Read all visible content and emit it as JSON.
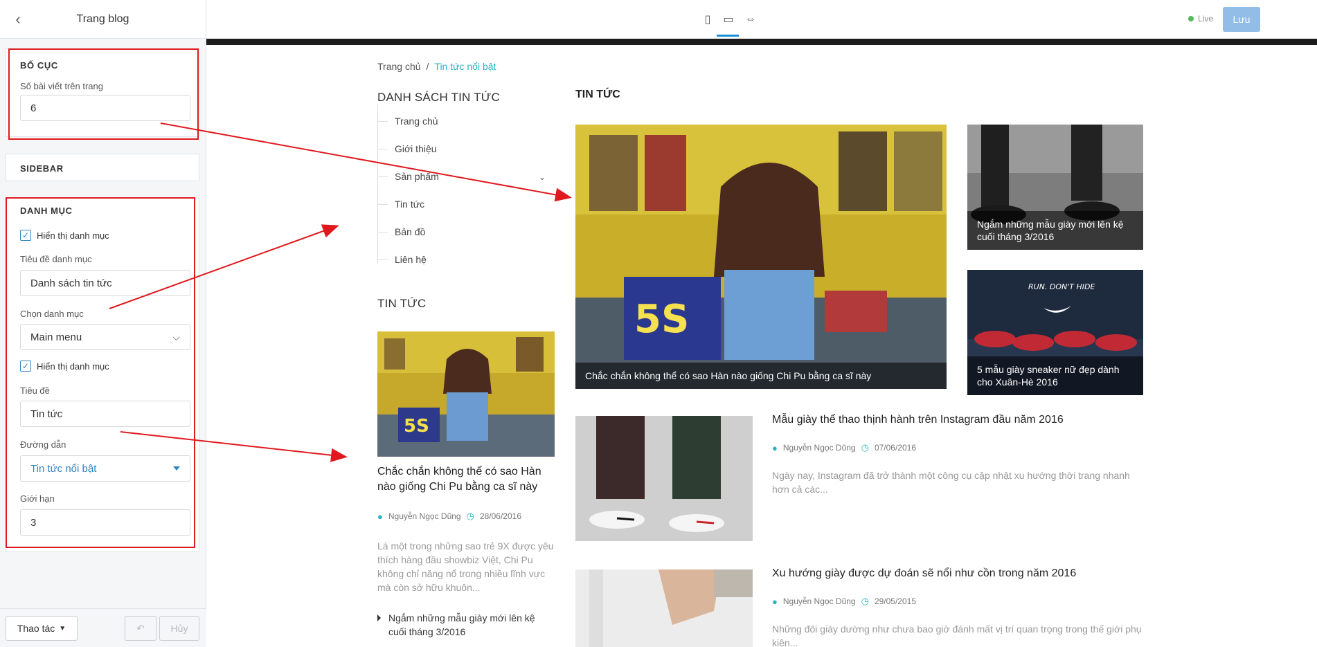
{
  "editor": {
    "title": "Trang blog",
    "back_icon": "chevron-left-icon",
    "layout": {
      "heading": "BỐ CỤC",
      "posts_per_page_label": "Số bài viết trên trang",
      "posts_per_page_value": "6"
    },
    "sidebar_section": {
      "heading": "SIDEBAR"
    },
    "category": {
      "heading": "DANH MỤC",
      "show_category_label": "Hiển thị danh mục",
      "show_category_checked": true,
      "category_title_label": "Tiêu đề danh mục",
      "category_title_value": "Danh sách tin tức",
      "choose_category_label": "Chọn danh mục",
      "choose_category_value": "Main menu",
      "show_category2_label": "Hiển thị danh mục",
      "show_category2_checked": true,
      "title_label": "Tiêu đề",
      "title_value": "Tin tức",
      "path_label": "Đường dẫn",
      "path_value": "Tin tức nổi bật",
      "limit_label": "Giới hạn",
      "limit_value": "3"
    },
    "footer": {
      "actions_label": "Thao tác",
      "cancel_label": "Hủy"
    }
  },
  "topbar": {
    "live_label": "Live",
    "save_label": "Lưu",
    "devices": [
      "mobile-icon",
      "desktop-icon",
      "full-width-icon"
    ],
    "accent": "#1a8fd8"
  },
  "preview": {
    "breadcrumb": {
      "home": "Trang chủ",
      "separator": "/",
      "current": "Tin tức nổi bật"
    },
    "nav_heading": "DANH SÁCH TIN TỨC",
    "nav_items": [
      "Trang chủ",
      "Giới thiệu",
      "Sản phẩm",
      "Tin tức",
      "Bản đồ",
      "Liên hệ"
    ],
    "news_heading": "TIN TỨC",
    "side_post": {
      "title": "Chắc chắn không thể có sao Hàn nào giống Chi Pu bằng ca sĩ này",
      "author": "Nguyễn Ngọc Dũng",
      "date": "28/06/2016",
      "excerpt": "Là một trong những sao trẻ 9X được yêu thích hàng đầu showbiz Việt, Chi Pu không chỉ năng nổ trong nhiều lĩnh vực mà còn sở hữu khuôn..."
    },
    "side_link": "Ngắm những mẫu giày mới lên kệ cuối tháng 3/2016",
    "main_heading": "TIN TỨC",
    "featured": [
      {
        "caption": "Chắc chắn không thể có sao Hàn nào giống Chi Pu bằng ca sĩ này"
      },
      {
        "caption": "Ngắm những mẫu giày mới lên kệ cuối tháng 3/2016"
      },
      {
        "caption": "5 mẫu giày sneaker nữ đẹp dành cho Xuân-Hè 2016"
      }
    ],
    "posts": [
      {
        "title": "Mẫu giày thể thao thịnh hành trên Instagram đầu năm 2016",
        "author": "Nguyễn Ngọc Dũng",
        "date": "07/06/2016",
        "excerpt": "Ngày nay, Instagram đã trở thành một công cụ cập nhật xu hướng thời trang nhanh hơn cả các..."
      },
      {
        "title": "Xu hướng giày được dự đoán sẽ nổi như cồn trong năm 2016",
        "author": "Nguyễn Ngọc Dũng",
        "date": "29/05/2015",
        "excerpt": "Những đôi giày dường như chưa bao giờ đánh mất vị trí quan trọng trong thế giới phụ kiện..."
      }
    ],
    "shoe_ad_text": "RUN. DON'T HIDE"
  }
}
